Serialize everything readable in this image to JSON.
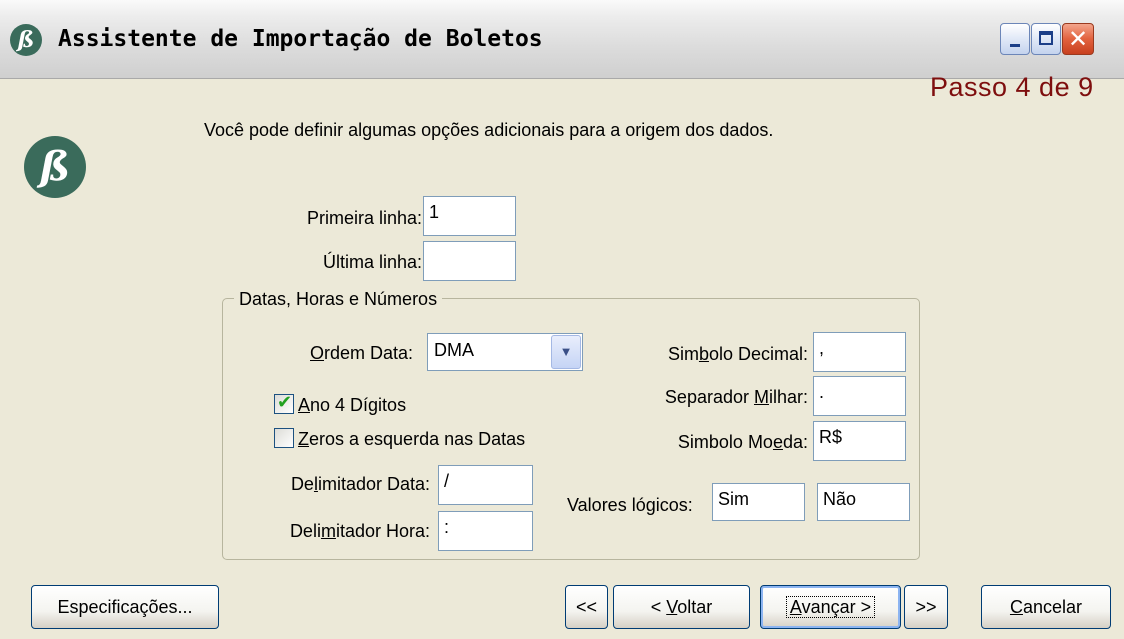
{
  "window": {
    "title": "Assistente de Importação de Boletos",
    "app_icon": "beta-logo-icon"
  },
  "step": "Passo 4 de 9",
  "intro": "Você pode definir algumas opções adicionais para a origem dos dados.",
  "rows": {
    "first_line_label": "Primeira linha:",
    "first_line_value": "1",
    "last_line_label": "Última linha:",
    "last_line_value": ""
  },
  "group": {
    "title": "Datas, Horas e Números",
    "date_order_label_u": "O",
    "date_order_label_rest": "rdem Data:",
    "date_order_value": "DMA",
    "year4_u": "A",
    "year4_rest": "no 4 Dígitos",
    "year4_checked": true,
    "zeros_u": "Z",
    "zeros_rest": "eros a esquerda nas Datas",
    "zeros_checked": false,
    "date_delim_a": "De",
    "date_delim_u": "l",
    "date_delim_b": "imitador Data:",
    "date_delim_value": "/",
    "time_delim_a": "Deli",
    "time_delim_u": "m",
    "time_delim_b": "itador Hora:",
    "time_delim_value": ":",
    "decimal_a": "Sim",
    "decimal_u": "b",
    "decimal_b": "olo Decimal:",
    "decimal_value": ",",
    "thousand_a": "Separador ",
    "thousand_u": "M",
    "thousand_b": "ilhar:",
    "thousand_value": ".",
    "currency_a": "Simbolo Mo",
    "currency_u": "e",
    "currency_b": "da:",
    "currency_value": "R$",
    "logical_label": "Valores lógicos:",
    "logical_true": "Sim",
    "logical_false": "Não"
  },
  "buttons": {
    "specs": "Especificações...",
    "first": "<<",
    "back_a": "< ",
    "back_u": "V",
    "back_b": "oltar",
    "next_u": "A",
    "next_b": "vançar >",
    "last": ">>",
    "cancel_u": "C",
    "cancel_b": "ancelar"
  },
  "colors": {
    "accent_step": "#7e0e0e",
    "logo": "#3a6b5b",
    "checkmark": "#21a121"
  }
}
